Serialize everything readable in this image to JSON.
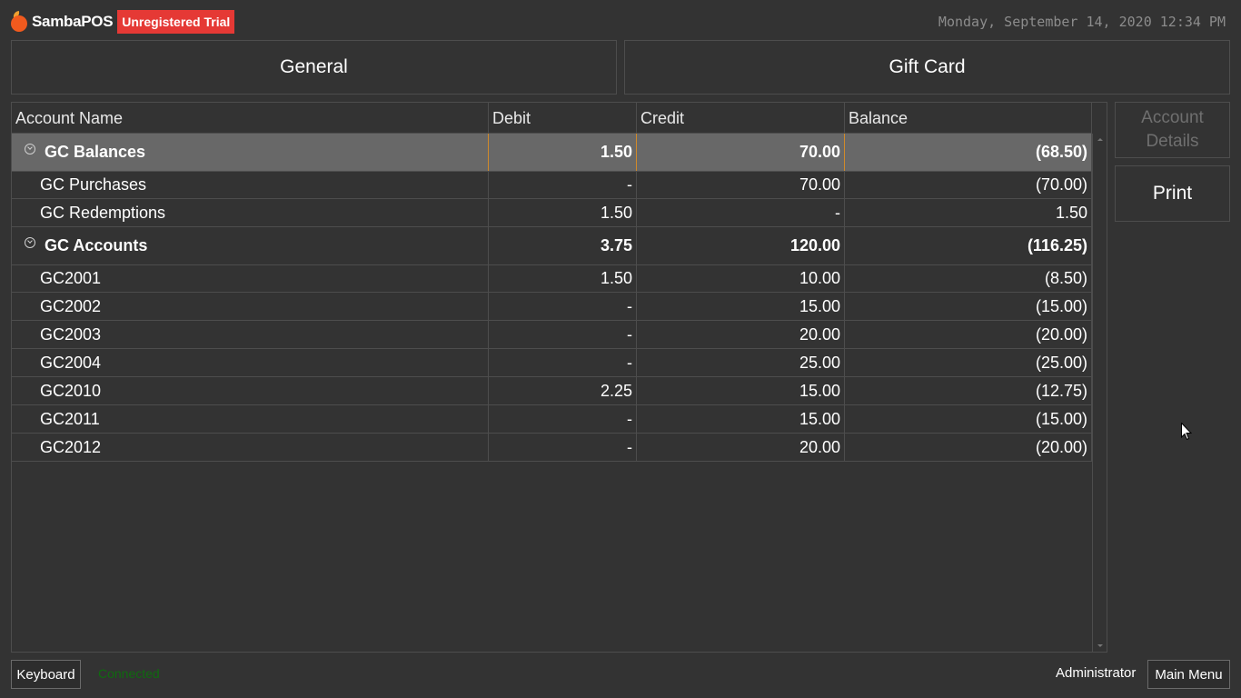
{
  "app": {
    "name": "SambaPOS",
    "badge": "Unregistered Trial",
    "datetime": "Monday, September 14, 2020 12:34 PM"
  },
  "tabs": [
    {
      "label": "General"
    },
    {
      "label": "Gift Card"
    }
  ],
  "grid": {
    "columns": [
      "Account Name",
      "Debit",
      "Credit",
      "Balance"
    ],
    "groups": [
      {
        "name": "GC Balances",
        "debit": "1.50",
        "credit": "70.00",
        "balance": "(68.50)",
        "selected": true,
        "rows": [
          {
            "name": "GC Purchases",
            "debit": "-",
            "credit": "70.00",
            "balance": "(70.00)"
          },
          {
            "name": "GC Redemptions",
            "debit": "1.50",
            "credit": "-",
            "balance": "1.50"
          }
        ]
      },
      {
        "name": "GC Accounts",
        "debit": "3.75",
        "credit": "120.00",
        "balance": "(116.25)",
        "selected": false,
        "rows": [
          {
            "name": "GC2001",
            "debit": "1.50",
            "credit": "10.00",
            "balance": "(8.50)"
          },
          {
            "name": "GC2002",
            "debit": "-",
            "credit": "15.00",
            "balance": "(15.00)"
          },
          {
            "name": "GC2003",
            "debit": "-",
            "credit": "20.00",
            "balance": "(20.00)"
          },
          {
            "name": "GC2004",
            "debit": "-",
            "credit": "25.00",
            "balance": "(25.00)"
          },
          {
            "name": "GC2010",
            "debit": "2.25",
            "credit": "15.00",
            "balance": "(12.75)"
          },
          {
            "name": "GC2011",
            "debit": "-",
            "credit": "15.00",
            "balance": "(15.00)"
          },
          {
            "name": "GC2012",
            "debit": "-",
            "credit": "20.00",
            "balance": "(20.00)"
          }
        ]
      }
    ]
  },
  "side_buttons": {
    "account_details": "Account Details",
    "print": "Print"
  },
  "footer": {
    "keyboard": "Keyboard",
    "status": "Connected",
    "user": "Administrator",
    "main_menu": "Main Menu"
  }
}
